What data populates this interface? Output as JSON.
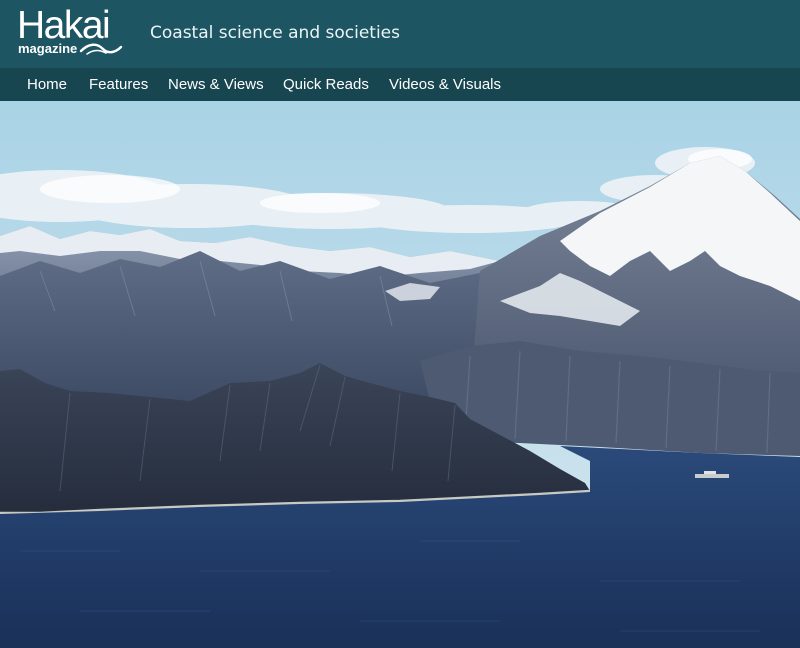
{
  "header": {
    "logo": {
      "wordmark": "Hakai",
      "subtitle": "magazine"
    },
    "tagline": "Coastal science and societies",
    "colors": {
      "header_bg": "#1e5563",
      "nav_bg": "#174550"
    }
  },
  "nav": {
    "items": [
      {
        "label": "Home"
      },
      {
        "label": "Features"
      },
      {
        "label": "News & Views"
      },
      {
        "label": "Quick Reads"
      },
      {
        "label": "Videos & Visuals"
      }
    ]
  },
  "hero": {
    "subject": "snow-capped mountains above a coastal inlet"
  }
}
